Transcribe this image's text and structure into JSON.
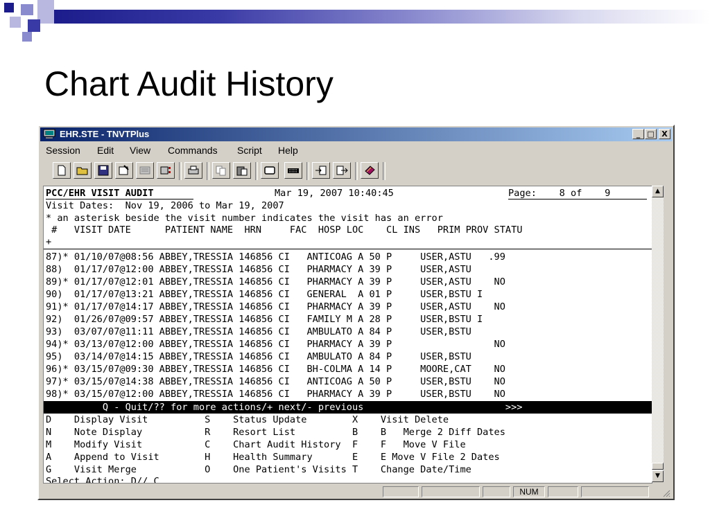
{
  "slide": {
    "title": "Chart Audit History"
  },
  "window": {
    "title": "EHR.STE - TNVTPlus",
    "minimize": "_",
    "maximize": "□",
    "close": "X"
  },
  "menu": [
    "Session",
    "Edit",
    "View",
    "Commands",
    "Script",
    "Help"
  ],
  "toolbar_icons": [
    "new-icon",
    "open-icon",
    "save-icon",
    "properties-icon",
    "keymap-icon",
    "colors-icon",
    "print-icon",
    "copy-icon",
    "paste-icon",
    "window-icon",
    "keyboard-icon",
    "send-file-icon",
    "receive-file-icon",
    "macro-icon"
  ],
  "terminal": {
    "header_left": "PCC/EHR VISIT AUDIT",
    "header_date": "Mar 19, 2007 10:40:45",
    "header_page": "Page:    8 of    9",
    "dates_line": "Visit Dates:  Nov 19, 2006 to Mar 19, 2007",
    "note_line": "* an asterisk beside the visit number indicates the visit has an error",
    "columns_line": " #   VISIT DATE      PATIENT NAME  HRN     FAC  HOSP LOC    CL INS   PRIM PROV STATU",
    "plus_line": "+",
    "rows": [
      "87)* 01/10/07@08:56 ABBEY,TRESSIA 146856 CI   ANTICOAG A 50 P     USER,ASTU   .99",
      "88)  01/17/07@12:00 ABBEY,TRESSIA 146856 CI   PHARMACY A 39 P     USER,ASTU",
      "89)* 01/17/07@12:01 ABBEY,TRESSIA 146856 CI   PHARMACY A 39 P     USER,ASTU    NO",
      "90)  01/17/07@13:21 ABBEY,TRESSIA 146856 CI   GENERAL  A 01 P     USER,BSTU I",
      "91)* 01/17/07@14:17 ABBEY,TRESSIA 146856 CI   PHARMACY A 39 P     USER,ASTU    NO",
      "92)  01/26/07@09:57 ABBEY,TRESSIA 146856 CI   FAMILY M A 28 P     USER,BSTU I",
      "93)  03/07/07@11:11 ABBEY,TRESSIA 146856 CI   AMBULATO A 84 P     USER,BSTU",
      "94)* 03/13/07@12:00 ABBEY,TRESSIA 146856 CI   PHARMACY A 39 P                  NO",
      "95)  03/14/07@14:15 ABBEY,TRESSIA 146856 CI   AMBULATO A 84 P     USER,BSTU",
      "96)* 03/15/07@09:30 ABBEY,TRESSIA 146856 CI   BH-COLMA A 14 P     MOORE,CAT    NO",
      "97)* 03/15/07@14:38 ABBEY,TRESSIA 146856 CI   ANTICOAG A 50 P     USER,BSTU    NO",
      "98)* 03/15/07@12:00 ABBEY,TRESSIA 146856 CI   PHARMACY A 39 P     USER,BSTU    NO"
    ],
    "prompt_bar": "          Q - Quit/?? for more actions/+ next/- previous                         >>>",
    "actions": [
      "D    Display Visit          S    Status Update        X    Visit Delete",
      "N    Note Display           R    Resort List          B    B   Merge 2 Diff Dates",
      "M    Modify Visit           C    Chart Audit History  F    F   Move V File",
      "A    Append to Visit        H    Health Summary       E    E Move V File 2 Dates",
      "G    Visit Merge            O    One Patient's Visits T    Change Date/Time"
    ],
    "select_line": "Select Action: D// C"
  },
  "status": {
    "num": "NUM"
  }
}
